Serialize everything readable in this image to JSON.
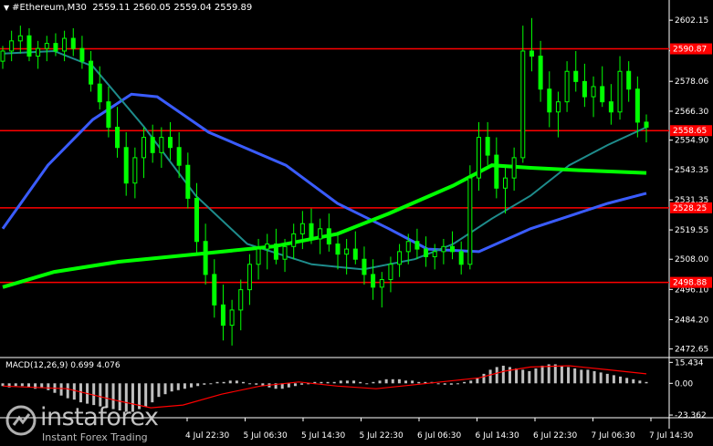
{
  "header": {
    "symbol": "#Ethereum,M30",
    "ohlc": "2559.11 2560.05 2559.04 2559.89"
  },
  "macd": {
    "label": "MACD(12,26,9) 0.699 4.076"
  },
  "watermark": {
    "brand": "instaforex",
    "tagline": "Instant Forex Trading"
  },
  "colors": {
    "background": "#000000",
    "candle": "#00ff00",
    "level_line": "#ff0000",
    "ma_fast": "#1e8c8c",
    "ma_mid": "#00ff00",
    "ma_slow": "#3a5cff",
    "macd_hist": "#c0c0c0",
    "macd_signal": "#ff0000"
  },
  "chart_data": {
    "type": "candlestick",
    "price_axis_labels": [
      2602.15,
      2590.1,
      2578.06,
      2566.3,
      2554.9,
      2543.35,
      2531.35,
      2519.55,
      2508.0,
      2496.1,
      2484.2,
      2472.65
    ],
    "ylim": [
      2470,
      2604
    ],
    "time_labels": [
      "4 Jul 22:30",
      "5 Jul 06:30",
      "5 Jul 14:30",
      "5 Jul 22:30",
      "6 Jul 06:30",
      "6 Jul 14:30",
      "6 Jul 22:30",
      "7 Jul 06:30",
      "7 Jul 14:30"
    ],
    "levels": [
      {
        "value": 2590.87,
        "label": "2590.87"
      },
      {
        "value": 2558.65,
        "label": "2558.65"
      },
      {
        "value": 2528.25,
        "label": "2528.25"
      },
      {
        "value": 2498.88,
        "label": "2498.88"
      }
    ],
    "current_price": 2559.89,
    "candles": [
      [
        2586,
        2592,
        2583,
        2590
      ],
      [
        2590,
        2598,
        2586,
        2594
      ],
      [
        2594,
        2600,
        2589,
        2596
      ],
      [
        2596,
        2599,
        2586,
        2588
      ],
      [
        2588,
        2594,
        2583,
        2591
      ],
      [
        2591,
        2596,
        2586,
        2593
      ],
      [
        2593,
        2597,
        2588,
        2590
      ],
      [
        2590,
        2598,
        2586,
        2595
      ],
      [
        2595,
        2599,
        2588,
        2591
      ],
      [
        2591,
        2596,
        2583,
        2586
      ],
      [
        2586,
        2590,
        2574,
        2577
      ],
      [
        2577,
        2584,
        2567,
        2570
      ],
      [
        2570,
        2576,
        2556,
        2560
      ],
      [
        2560,
        2568,
        2548,
        2552
      ],
      [
        2552,
        2558,
        2533,
        2538
      ],
      [
        2538,
        2552,
        2532,
        2548
      ],
      [
        2548,
        2560,
        2540,
        2556
      ],
      [
        2556,
        2561,
        2546,
        2550
      ],
      [
        2550,
        2560,
        2544,
        2556
      ],
      [
        2556,
        2562,
        2547,
        2552
      ],
      [
        2552,
        2558,
        2540,
        2545
      ],
      [
        2545,
        2550,
        2528,
        2532
      ],
      [
        2532,
        2538,
        2510,
        2515
      ],
      [
        2515,
        2522,
        2498,
        2502
      ],
      [
        2502,
        2508,
        2485,
        2490
      ],
      [
        2490,
        2498,
        2476,
        2482
      ],
      [
        2482,
        2492,
        2474,
        2488
      ],
      [
        2488,
        2500,
        2480,
        2496
      ],
      [
        2496,
        2510,
        2490,
        2506
      ],
      [
        2506,
        2516,
        2500,
        2512
      ],
      [
        2512,
        2518,
        2504,
        2514
      ],
      [
        2514,
        2520,
        2506,
        2508
      ],
      [
        2508,
        2516,
        2503,
        2513
      ],
      [
        2513,
        2522,
        2508,
        2518
      ],
      [
        2518,
        2527,
        2512,
        2522
      ],
      [
        2522,
        2528,
        2514,
        2516
      ],
      [
        2516,
        2524,
        2510,
        2520
      ],
      [
        2520,
        2526,
        2511,
        2514
      ],
      [
        2514,
        2518,
        2504,
        2510
      ],
      [
        2510,
        2516,
        2502,
        2512
      ],
      [
        2512,
        2519,
        2506,
        2508
      ],
      [
        2508,
        2513,
        2498,
        2502
      ],
      [
        2502,
        2508,
        2492,
        2497
      ],
      [
        2497,
        2503,
        2489,
        2500
      ],
      [
        2500,
        2509,
        2495,
        2506
      ],
      [
        2506,
        2514,
        2501,
        2511
      ],
      [
        2511,
        2518,
        2506,
        2515
      ],
      [
        2515,
        2520,
        2508,
        2512
      ],
      [
        2512,
        2517,
        2505,
        2509
      ],
      [
        2509,
        2514,
        2504,
        2511
      ],
      [
        2511,
        2516,
        2506,
        2513
      ],
      [
        2513,
        2519,
        2508,
        2511
      ],
      [
        2511,
        2515,
        2502,
        2506
      ],
      [
        2506,
        2545,
        2504,
        2540
      ],
      [
        2540,
        2562,
        2535,
        2556
      ],
      [
        2556,
        2562,
        2545,
        2549
      ],
      [
        2549,
        2556,
        2532,
        2536
      ],
      [
        2536,
        2545,
        2526,
        2540
      ],
      [
        2540,
        2552,
        2535,
        2548
      ],
      [
        2548,
        2600,
        2546,
        2590
      ],
      [
        2590,
        2603,
        2582,
        2588
      ],
      [
        2588,
        2594,
        2570,
        2575
      ],
      [
        2575,
        2582,
        2560,
        2566
      ],
      [
        2566,
        2574,
        2556,
        2570
      ],
      [
        2570,
        2586,
        2566,
        2582
      ],
      [
        2582,
        2590,
        2574,
        2578
      ],
      [
        2578,
        2585,
        2568,
        2572
      ],
      [
        2572,
        2580,
        2564,
        2576
      ],
      [
        2576,
        2584,
        2568,
        2570
      ],
      [
        2570,
        2577,
        2561,
        2566
      ],
      [
        2566,
        2588,
        2563,
        2582
      ],
      [
        2582,
        2586,
        2570,
        2575
      ],
      [
        2575,
        2580,
        2556,
        2562
      ],
      [
        2562,
        2565,
        2554,
        2560
      ]
    ],
    "ma_fast": [
      [
        0,
        2589
      ],
      [
        0.08,
        2590
      ],
      [
        0.14,
        2584
      ],
      [
        0.22,
        2560
      ],
      [
        0.3,
        2533
      ],
      [
        0.38,
        2514
      ],
      [
        0.48,
        2506
      ],
      [
        0.56,
        2504
      ],
      [
        0.64,
        2508
      ],
      [
        0.7,
        2514
      ],
      [
        0.76,
        2524
      ],
      [
        0.82,
        2533
      ],
      [
        0.88,
        2545
      ],
      [
        0.94,
        2553
      ],
      [
        1,
        2560
      ]
    ],
    "ma_mid": [
      [
        0,
        2497
      ],
      [
        0.08,
        2503
      ],
      [
        0.18,
        2507
      ],
      [
        0.3,
        2510
      ],
      [
        0.42,
        2513
      ],
      [
        0.52,
        2518
      ],
      [
        0.6,
        2526
      ],
      [
        0.7,
        2537
      ],
      [
        0.76,
        2545
      ],
      [
        0.82,
        2544
      ],
      [
        0.9,
        2543
      ],
      [
        1,
        2542
      ]
    ],
    "ma_slow": [
      [
        0,
        2520
      ],
      [
        0.07,
        2545
      ],
      [
        0.14,
        2563
      ],
      [
        0.2,
        2573
      ],
      [
        0.24,
        2572
      ],
      [
        0.32,
        2558
      ],
      [
        0.44,
        2545
      ],
      [
        0.52,
        2530
      ],
      [
        0.6,
        2520
      ],
      [
        0.66,
        2512
      ],
      [
        0.74,
        2511
      ],
      [
        0.82,
        2520
      ],
      [
        0.88,
        2525
      ],
      [
        0.94,
        2530
      ],
      [
        1,
        2534
      ]
    ],
    "macd_axis_labels": [
      15.434,
      0.0,
      -23.362
    ],
    "macd_ylim": [
      -24,
      17
    ],
    "macd_histogram": [
      -2,
      -3,
      -2,
      -2,
      -3,
      -4,
      -3,
      -5,
      -7,
      -9,
      -11,
      -12,
      -14,
      -15,
      -16,
      -17,
      -18,
      -19,
      -20,
      -21,
      -21,
      -19,
      -17,
      -14,
      -10,
      -8,
      -6,
      -5,
      -4,
      -3,
      -2,
      -1,
      0,
      1,
      1,
      2,
      2,
      1,
      0,
      -1,
      -2,
      -3,
      -4,
      -4,
      -3,
      -2,
      -1,
      0,
      1,
      1,
      1,
      1,
      2,
      2,
      2,
      1,
      0,
      1,
      2,
      3,
      3,
      3,
      2,
      2,
      1,
      1,
      1,
      0,
      -1,
      -1,
      0,
      1,
      2,
      4,
      7,
      10,
      12,
      13,
      12,
      11,
      10,
      9,
      11,
      13,
      14,
      14,
      13,
      12,
      11,
      10,
      10,
      9,
      8,
      7,
      6,
      5,
      4,
      3,
      2,
      1
    ],
    "macd_signal": [
      [
        0,
        -2
      ],
      [
        0.1,
        -4
      ],
      [
        0.17,
        -12
      ],
      [
        0.23,
        -18
      ],
      [
        0.28,
        -16
      ],
      [
        0.34,
        -8
      ],
      [
        0.4,
        -2
      ],
      [
        0.46,
        1
      ],
      [
        0.52,
        -2
      ],
      [
        0.58,
        -4
      ],
      [
        0.64,
        -1
      ],
      [
        0.7,
        2
      ],
      [
        0.74,
        4
      ],
      [
        0.78,
        9
      ],
      [
        0.82,
        12
      ],
      [
        0.88,
        13
      ],
      [
        0.94,
        10
      ],
      [
        1,
        7
      ]
    ]
  }
}
